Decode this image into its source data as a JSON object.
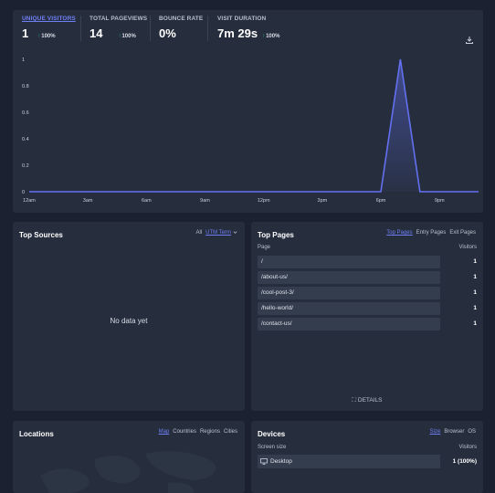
{
  "stats": [
    {
      "label": "Unique visitors",
      "value": "1",
      "change": "100%",
      "active": true
    },
    {
      "label": "Total pageviews",
      "value": "14",
      "change": "100%",
      "active": false
    },
    {
      "label": "Bounce rate",
      "value": "0%",
      "change": "",
      "active": false
    },
    {
      "label": "Visit duration",
      "value": "7m 29s",
      "change": "100%",
      "active": false
    }
  ],
  "icons": {
    "download": "download-icon",
    "change_arrow": "arrow-up-icon",
    "chevron": "chevron-down-icon",
    "monitor": "monitor-icon",
    "expand": "expand-icon"
  },
  "colors": {
    "accent": "#6f7ff5",
    "line": "#6370f0",
    "up": "#10b981"
  },
  "chart_data": {
    "type": "area",
    "x": [
      "12am",
      "1am",
      "2am",
      "3am",
      "4am",
      "5am",
      "6am",
      "7am",
      "8am",
      "9am",
      "10am",
      "11am",
      "12pm",
      "1pm",
      "2pm",
      "3pm",
      "4pm",
      "5pm",
      "6pm",
      "7pm",
      "8pm",
      "9pm",
      "10pm",
      "11pm"
    ],
    "series": [
      {
        "values": [
          0,
          0,
          0,
          0,
          0,
          0,
          0,
          0,
          0,
          0,
          0,
          0,
          0,
          0,
          0,
          0,
          0,
          0,
          0,
          1,
          0,
          0,
          0,
          0
        ]
      }
    ],
    "xticks": [
      "12am",
      "3am",
      "6am",
      "9am",
      "12pm",
      "3pm",
      "6pm",
      "9pm"
    ],
    "yticks": [
      "0",
      "0.2",
      "0.4",
      "0.6",
      "0.8",
      "1"
    ],
    "ylim": [
      0,
      1
    ],
    "grid": false
  },
  "sources": {
    "title": "Top Sources",
    "tabs": [
      "All",
      "UTM Term"
    ],
    "active_tab": "UTM Term",
    "empty": "No data yet"
  },
  "pages": {
    "title": "Top Pages",
    "tabs": [
      "Top Pages",
      "Entry Pages",
      "Exit Pages"
    ],
    "active_tab": "Top Pages",
    "col_page": "Page",
    "col_visitors": "Visitors",
    "rows": [
      {
        "page": "/",
        "visitors": "1"
      },
      {
        "page": "/about-us/",
        "visitors": "1"
      },
      {
        "page": "/cool-post-3/",
        "visitors": "1"
      },
      {
        "page": "/hello-world/",
        "visitors": "1"
      },
      {
        "page": "/contact-us/",
        "visitors": "1"
      }
    ],
    "details": "DETAILS"
  },
  "locations": {
    "title": "Locations",
    "tabs": [
      "Map",
      "Countries",
      "Regions",
      "Cities"
    ],
    "active_tab": "Map"
  },
  "devices": {
    "title": "Devices",
    "tabs": [
      "Size",
      "Browser",
      "OS"
    ],
    "active_tab": "Size",
    "col_size": "Screen size",
    "col_visitors": "Visitors",
    "rows": [
      {
        "name": "Desktop",
        "visitors": "1",
        "percent": "(100%)"
      }
    ]
  }
}
